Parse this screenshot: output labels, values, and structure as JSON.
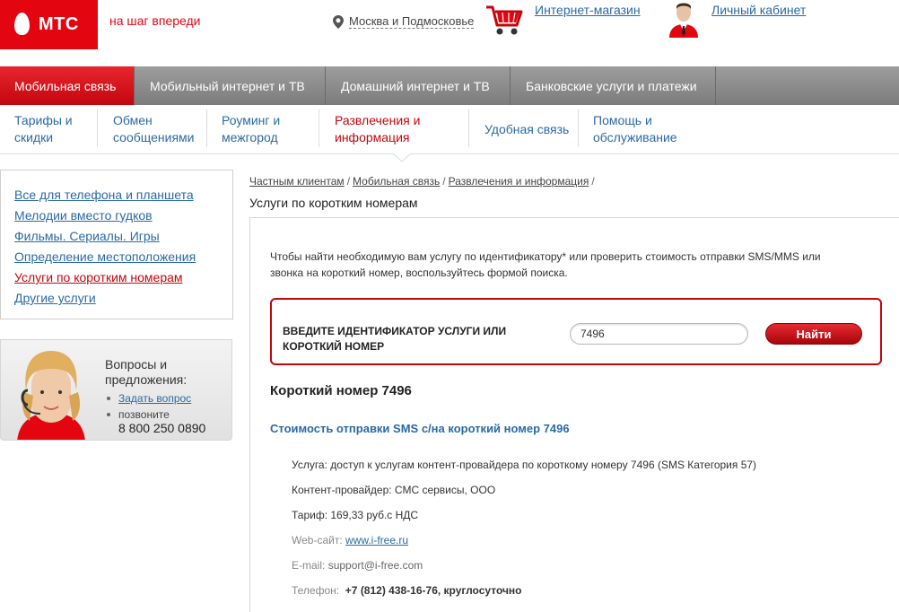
{
  "header": {
    "logo_text": "МТС",
    "slogan": "на шаг впереди",
    "region": "Москва и Подмосковье",
    "shop_link": "Интернет-магазин",
    "cabinet_link": "Личный кабинет"
  },
  "topnav": {
    "items": [
      {
        "label": "Мобильная связь",
        "active": true
      },
      {
        "label": "Мобильный интернет и ТВ",
        "active": false
      },
      {
        "label": "Домашний интернет и ТВ",
        "active": false
      },
      {
        "label": "Банковские услуги и платежи",
        "active": false
      }
    ]
  },
  "subnav": {
    "items": [
      {
        "line1": "Тарифы и",
        "line2": "скидки"
      },
      {
        "line1": "Обмен",
        "line2": "сообщениями"
      },
      {
        "line1": "Роуминг и",
        "line2": "межгород"
      },
      {
        "line1": "Развлечения и",
        "line2": "информация"
      },
      {
        "line1": "Удобная связь",
        "line2": ""
      },
      {
        "line1": "Помощь и",
        "line2": "обслуживание"
      }
    ]
  },
  "leftmenu": {
    "items": [
      "Все для телефона и планшета",
      "Мелодии вместо гудков",
      "Фильмы. Сериалы. Игры",
      "Определение местоположения",
      "Услуги по коротким номерам",
      "Другие услуги"
    ]
  },
  "contact": {
    "title_line1": "Вопросы и",
    "title_line2": "предложения:",
    "ask_link": "Задать вопрос",
    "call_label": "позвоните",
    "phone": "8 800 250 0890"
  },
  "breadcrumbs": [
    "Частным клиентам",
    "Мобильная связь",
    "Развлечения и информация"
  ],
  "main": {
    "page_title": "Услуги по коротким номерам",
    "intro_line1": "Чтобы найти необходимую вам услугу по идентификатору* или проверить стоимость отправки SMS/MMS или",
    "intro_line2": "звонка на короткий номер, воспользуйтесь формой поиска.",
    "search_label_line1": "ВВЕДИТЕ ИДЕНТИФИКАТОР УСЛУГИ ИЛИ",
    "search_label_line2": "КОРОТКИЙ НОМЕР",
    "search_value": "7496",
    "search_button": "Найти",
    "number_title": "Короткий номер 7496",
    "cost_title": "Стоимость отправки SMS с/на короткий номер 7496",
    "service": "Услуга: доступ к услугам контент-провайдера по короткому номеру 7496 (SMS Категория 57)",
    "provider": "Контент-провайдер: СМС сервисы, ООО",
    "tariff": "Тариф: 169,33 руб.с НДС",
    "website_label": "Web-сайт:",
    "website_value": "www.i-free.ru",
    "email_label": "E-mail:",
    "email_value": "support@i-free.com",
    "phone_label": "Телефон:",
    "phone_value": "+7 (812) 438-16-76, круглосуточно"
  },
  "colors": {
    "brand_red": "#e30611",
    "link_blue": "#2b6aa4",
    "nav_grey": "#8a8a8a"
  }
}
